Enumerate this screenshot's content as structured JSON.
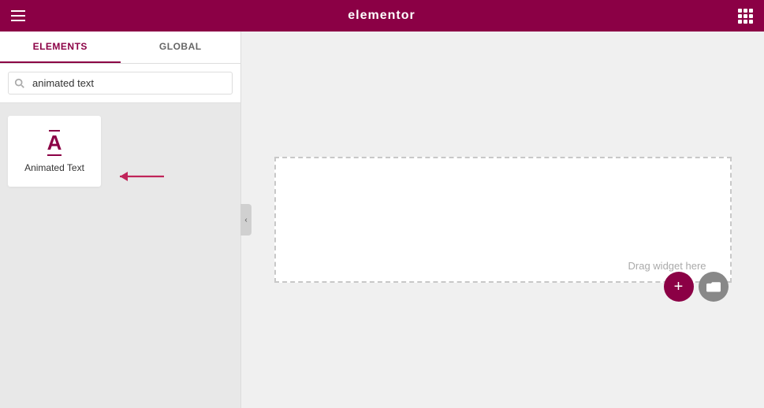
{
  "topbar": {
    "title": "elementor",
    "hamburger_label": "menu",
    "grid_label": "apps"
  },
  "sidebar": {
    "tabs": [
      {
        "id": "elements",
        "label": "ELEMENTS",
        "active": true
      },
      {
        "id": "global",
        "label": "GLOBAL",
        "active": false
      }
    ],
    "search": {
      "placeholder": "animated text",
      "value": "animated text"
    },
    "widgets": [
      {
        "id": "animated-text",
        "label": "Animated Text",
        "icon": "A"
      }
    ]
  },
  "canvas": {
    "drag_hint": "Drag widget here",
    "add_button_label": "+",
    "folder_button_label": "⬛"
  },
  "collapse": {
    "label": "‹"
  }
}
